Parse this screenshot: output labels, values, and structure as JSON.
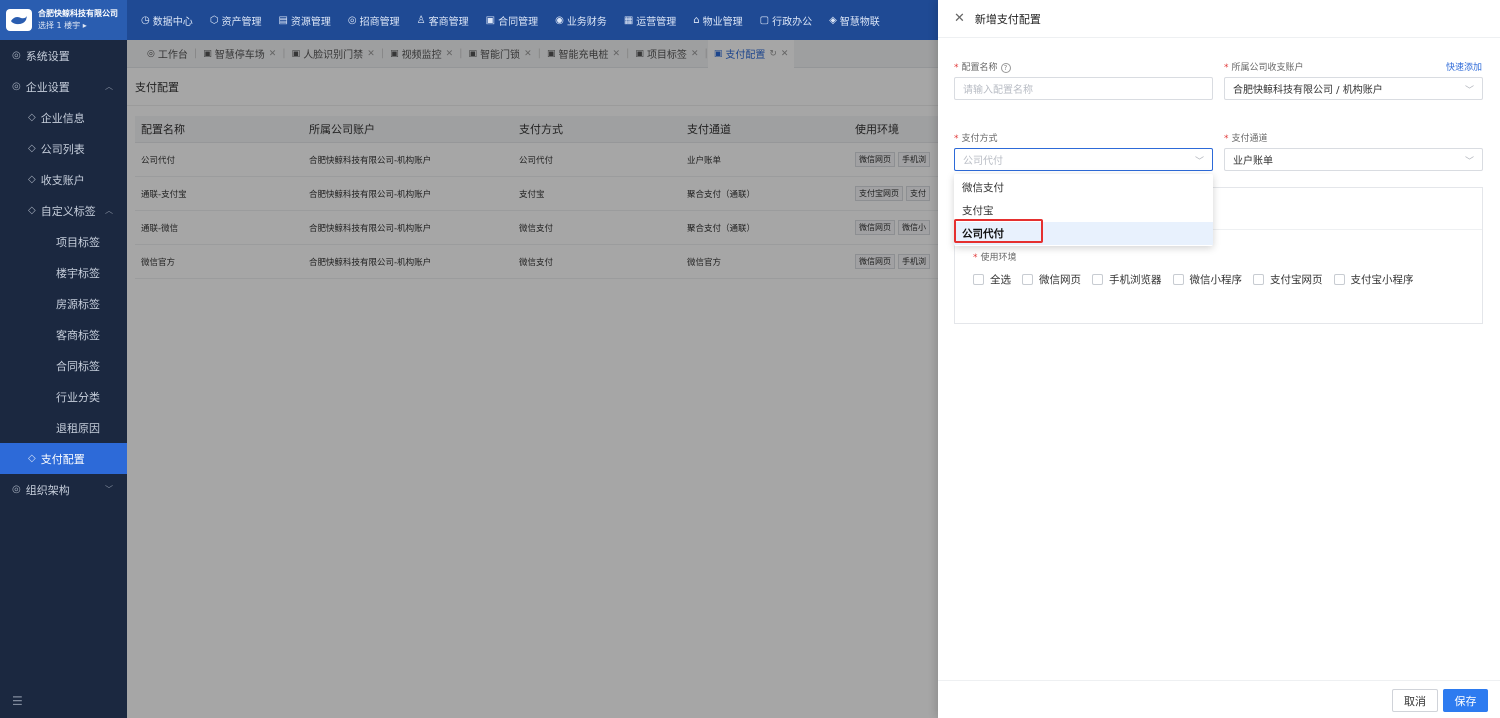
{
  "brand": {
    "name": "合肥快鲸科技有限公司",
    "sub": "选择 1 楼宇 ▸"
  },
  "nav": [
    "数据中心",
    "资产管理",
    "资源管理",
    "招商管理",
    "客商管理",
    "合同管理",
    "业务财务",
    "运营管理",
    "物业管理",
    "行政办公",
    "智慧物联"
  ],
  "sidebar": {
    "items": [
      {
        "label": "系统设置",
        "level": 1
      },
      {
        "label": "企业设置",
        "level": 1,
        "arrow": "^"
      },
      {
        "label": "企业信息",
        "level": 2
      },
      {
        "label": "公司列表",
        "level": 2
      },
      {
        "label": "收支账户",
        "level": 2
      },
      {
        "label": "自定义标签",
        "level": 2,
        "arrow": "^"
      },
      {
        "label": "项目标签",
        "level": 3
      },
      {
        "label": "楼宇标签",
        "level": 3
      },
      {
        "label": "房源标签",
        "level": 3
      },
      {
        "label": "客商标签",
        "level": 3
      },
      {
        "label": "合同标签",
        "level": 3
      },
      {
        "label": "行业分类",
        "level": 3
      },
      {
        "label": "退租原因",
        "level": 3
      },
      {
        "label": "支付配置",
        "level": 2,
        "active": true
      },
      {
        "label": "组织架构",
        "level": 1,
        "arrow": "v"
      }
    ]
  },
  "tabs": [
    {
      "label": "工作台"
    },
    {
      "label": "智慧停车场"
    },
    {
      "label": "人脸识别门禁"
    },
    {
      "label": "视频监控"
    },
    {
      "label": "智能门锁"
    },
    {
      "label": "智能充电桩"
    },
    {
      "label": "项目标签"
    },
    {
      "label": "支付配置",
      "active": true
    }
  ],
  "page": {
    "breadcrumb": "支付配置"
  },
  "table": {
    "headers": [
      "配置名称",
      "所属公司账户",
      "支付方式",
      "支付通道",
      "使用环境"
    ],
    "rows": [
      [
        "公司代付",
        "合肥快鲸科技有限公司-机构账户",
        "公司代付",
        "业户账单",
        "微信网页|手机浏"
      ],
      [
        "通联-支付宝",
        "合肥快鲸科技有限公司-机构账户",
        "支付宝",
        "聚合支付（通联）",
        "支付宝网页|支付"
      ],
      [
        "通联-微信",
        "合肥快鲸科技有限公司-机构账户",
        "微信支付",
        "聚合支付（通联）",
        "微信网页|微信小"
      ],
      [
        "微信官方",
        "合肥快鲸科技有限公司-机构账户",
        "微信支付",
        "微信官方",
        "微信网页|手机浏"
      ]
    ]
  },
  "drawer": {
    "title": "新增支付配置",
    "config_name_label": "配置名称",
    "config_name_placeholder": "请输入配置名称",
    "account_label": "所属公司收支账户",
    "quick_add": "快速添加",
    "account_value": "合肥快鲸科技有限公司 / 机构账户",
    "pay_method_label": "支付方式",
    "pay_method_placeholder": "公司代付",
    "channel_label": "支付通道",
    "channel_value": "业户账单",
    "dropdown_options": [
      "微信支付",
      "支付宝",
      "公司代付"
    ],
    "env_label": "使用环境",
    "env_options": [
      "全选",
      "微信网页",
      "手机浏览器",
      "微信小程序",
      "支付宝网页",
      "支付宝小程序"
    ],
    "cancel": "取消",
    "save": "保存"
  },
  "colors": {
    "nav_bg": "#1f4a94",
    "sidebar_bg": "#1b2840",
    "primary": "#2d6ad8",
    "highlight": "#e5302f"
  }
}
